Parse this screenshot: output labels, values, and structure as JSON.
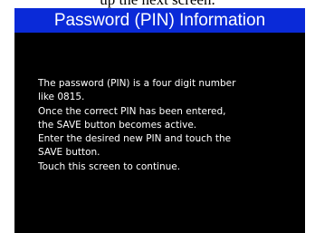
{
  "caption": "up the next screen.",
  "screen": {
    "title": "Password (PIN) Information",
    "colors": {
      "title_bar": "#0a2ad8",
      "background": "#000000",
      "text": "#ffffff"
    },
    "lines": [
      "The password (PIN) is a four digit number",
      "like 0815.",
      "Once the correct PIN has been entered,",
      "the SAVE button becomes active.",
      "Enter the desired new PIN and touch the",
      "SAVE button.",
      "Touch this screen to continue."
    ]
  }
}
